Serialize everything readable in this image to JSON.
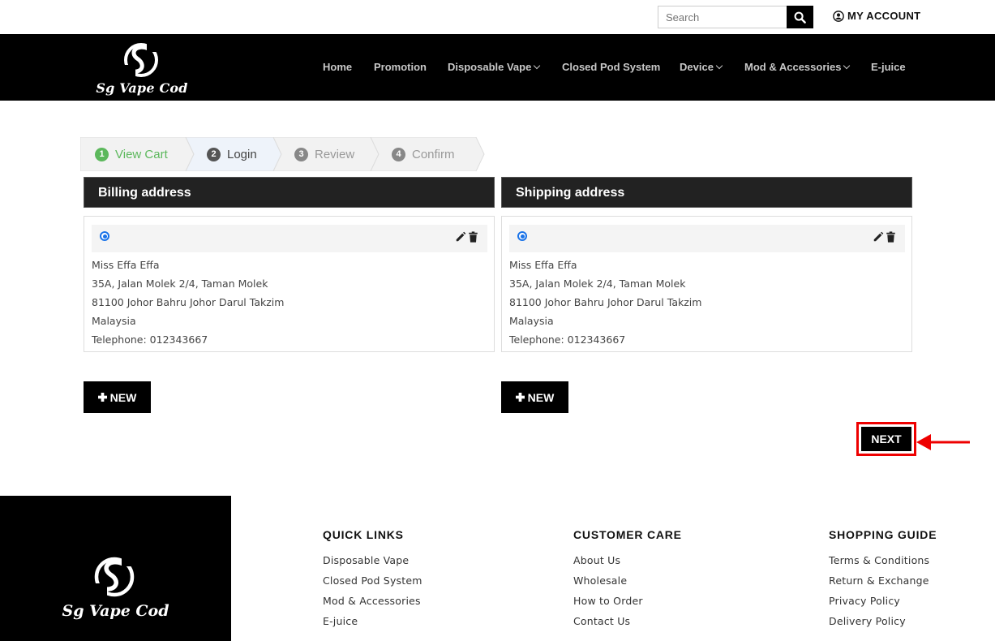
{
  "topbar": {
    "search_placeholder": "Search",
    "account_label": "MY ACCOUNT"
  },
  "brand": {
    "name": "Sg Vape Cod"
  },
  "nav": {
    "items": [
      {
        "label": "Home",
        "has_dropdown": false
      },
      {
        "label": "Promotion",
        "has_dropdown": false
      },
      {
        "label": "Disposable Vape",
        "has_dropdown": true
      },
      {
        "label": "Closed Pod System",
        "has_dropdown": false
      },
      {
        "label": "Device",
        "has_dropdown": true
      },
      {
        "label": "Mod & Accessories",
        "has_dropdown": true
      },
      {
        "label": "E-juice",
        "has_dropdown": false
      }
    ]
  },
  "steps": [
    {
      "num": "1",
      "label": "View Cart",
      "state": "done",
      "color": "#5cb85c"
    },
    {
      "num": "2",
      "label": "Login",
      "state": "active",
      "color": "#555555"
    },
    {
      "num": "3",
      "label": "Review",
      "state": "pending",
      "color": "#888888"
    },
    {
      "num": "4",
      "label": "Confirm",
      "state": "pending",
      "color": "#888888"
    }
  ],
  "billing": {
    "title": "Billing address",
    "name": "Miss Effa Effa",
    "line1": "35A, Jalan Molek 2/4, Taman Molek",
    "line2": "81100 Johor Bahru Johor Darul Takzim",
    "country": "Malaysia",
    "phone": "Telephone: 012343667",
    "new_label": "NEW"
  },
  "shipping": {
    "title": "Shipping address",
    "name": "Miss Effa Effa",
    "line1": "35A, Jalan Molek 2/4, Taman Molek",
    "line2": "81100 Johor Bahru Johor Darul Takzim",
    "country": "Malaysia",
    "phone": "Telephone: 012343667",
    "new_label": "NEW"
  },
  "next_label": "NEXT",
  "colors": {
    "header_bg": "#000000",
    "highlight": "#e00000",
    "radio": "#1a73e8"
  },
  "footer": {
    "quick_links": {
      "title": "QUICK LINKS",
      "links": [
        "Disposable Vape",
        "Closed Pod System",
        "Mod & Accessories",
        "E-juice"
      ]
    },
    "customer_care": {
      "title": "CUSTOMER CARE",
      "links": [
        "About Us",
        "Wholesale",
        "How to Order",
        "Contact Us"
      ]
    },
    "shopping_guide": {
      "title": "SHOPPING GUIDE",
      "links": [
        "Terms & Conditions",
        "Return & Exchange",
        "Privacy Policy",
        "Delivery Policy"
      ]
    }
  }
}
